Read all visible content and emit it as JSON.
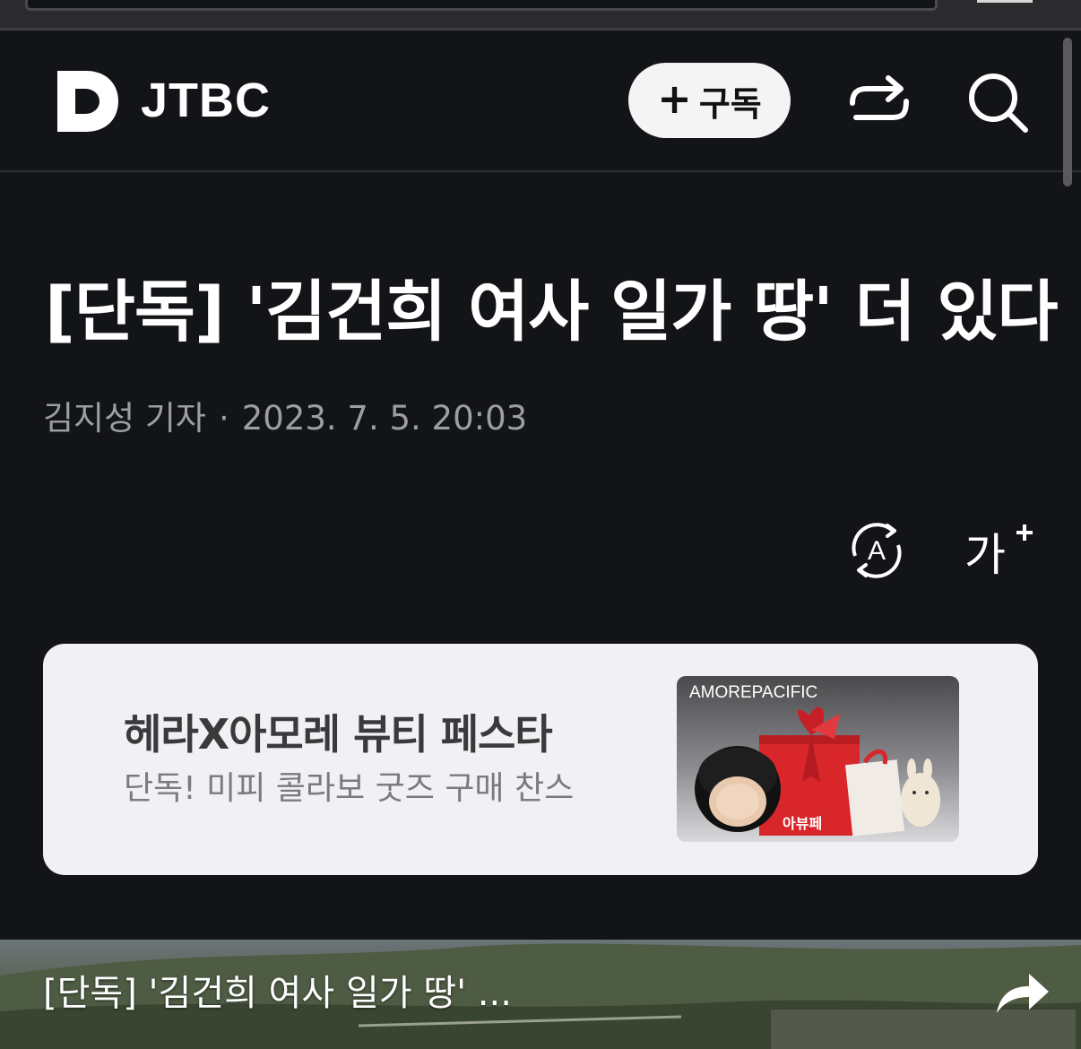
{
  "header": {
    "brand_logo_letter": "D",
    "brand_name": "JTBC",
    "subscribe_plus": "+",
    "subscribe_label": "구독"
  },
  "article": {
    "headline": "[단독] '김건희 여사 일가 땅' 더 있다",
    "reporter": "김지성 기자",
    "separator": "·",
    "datetime": "2023. 7. 5. 20:03",
    "translate_icon_letter": "A",
    "font_size_label": "가"
  },
  "ad": {
    "title": "헤라X아모레 뷰티 페스타",
    "subtitle": "단독! 미피 콜라보 굿즈 구매 찬스",
    "image_brand": "AMOREPACIFIC"
  },
  "video": {
    "title": "[단독] '김건희 여사 일가 땅' ..."
  },
  "colors": {
    "background": "#131417",
    "text_primary": "#ffffff",
    "text_secondary": "#9c9ea3",
    "ad_background": "#f1f1f3",
    "ad_title": "#3a3a3c",
    "gift_red": "#d8262b"
  }
}
